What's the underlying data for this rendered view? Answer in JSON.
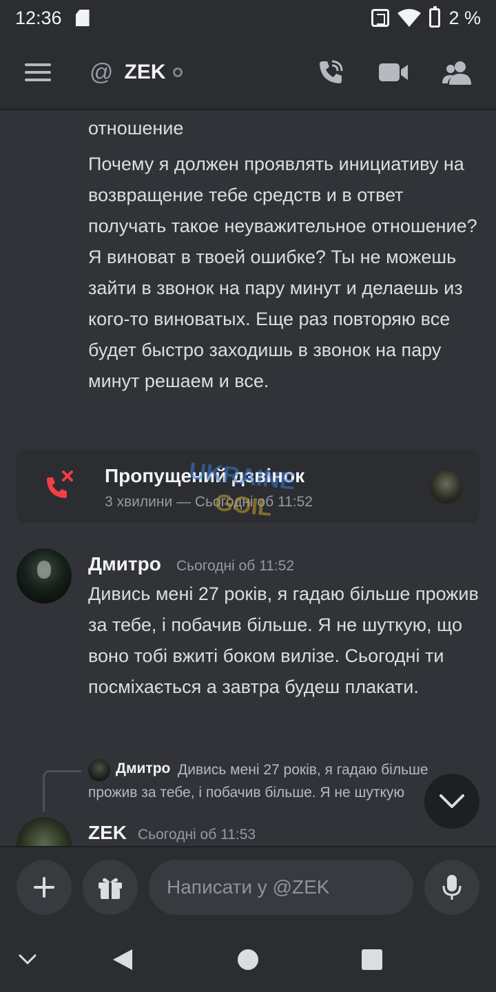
{
  "status_bar": {
    "time": "12:36",
    "battery": "2 %"
  },
  "header": {
    "at_symbol": "@",
    "name": "ZEK"
  },
  "messages": {
    "prev_tail": "отношение",
    "prev_body": "Почему я должен проявлять инициативу на возвращение тебе средств и в ответ получать такое неуважительное отношение? Я виноват в твоей ошибке? Ты не можешь зайти в звонок на пару минут и делаешь из кого-то виноватых. Еще раз повторяю все будет быстро заходишь в звонок на пару минут решаем и все.",
    "missed_call": {
      "title": "Пропущений дзвінок",
      "subtitle": "3 хвилини — Сьогодні об 11:52"
    },
    "dmytro": {
      "author": "Дмитро",
      "timestamp": "Сьогодні об 11:52",
      "text": "Дивись мені 27 років, я гадаю більше прожив за тебе, і побачив більше. Я не шуткую, що воно тобі вжиті боком вилізе.  Сьогодні ти посміхається а завтра будеш плакати."
    },
    "reply": {
      "author": "Дмитро",
      "line1": "Дивись мені 27 років, я гадаю більше",
      "line2": "прожив за тебе, і побачив більше. Я не шуткую"
    },
    "zek": {
      "author": "ZEK",
      "timestamp": "Сьогодні об 11:53"
    }
  },
  "composer": {
    "placeholder": "Написати у @ZEK"
  },
  "colors": {
    "background": "#313338",
    "panel": "#2b2d31",
    "missed_red": "#f23f43",
    "muted": "#949ba4"
  },
  "icons": [
    "hamburger-icon",
    "phone-call-icon",
    "video-icon",
    "members-icon",
    "missed-call-icon",
    "chevron-down-icon",
    "plus-icon",
    "gift-icon",
    "emoji-icon",
    "mic-icon",
    "nav-back-icon",
    "nav-home-icon",
    "nav-recents-icon"
  ]
}
